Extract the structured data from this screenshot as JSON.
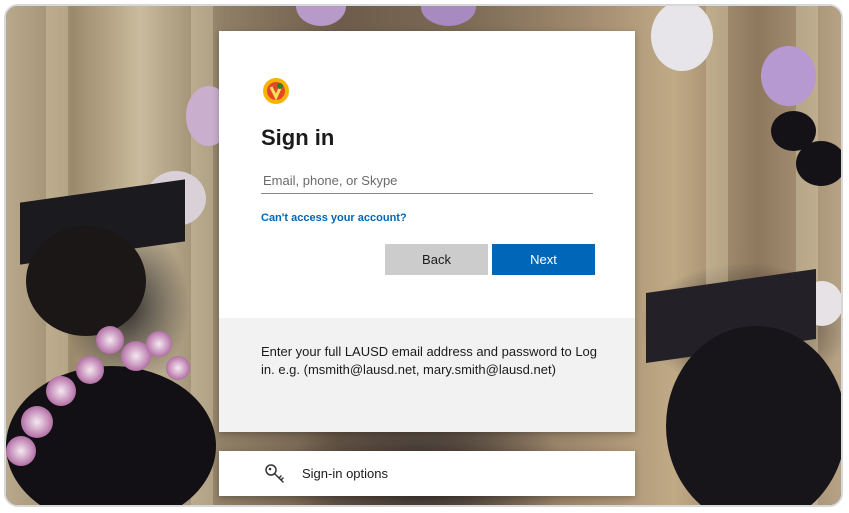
{
  "signin": {
    "title": "Sign in",
    "email_placeholder": "Email, phone, or Skype",
    "email_value": "",
    "cant_access_link": "Can't access your account?",
    "back_label": "Back",
    "next_label": "Next",
    "info_text": "Enter your full LAUSD email address and password to Log in. e.g. (msmith@lausd.net, mary.smith@lausd.net)"
  },
  "options": {
    "label": "Sign-in options",
    "icon": "key-icon"
  },
  "colors": {
    "accent": "#0067b8",
    "back_button": "#cccccc",
    "info_panel": "#f2f2f2"
  }
}
